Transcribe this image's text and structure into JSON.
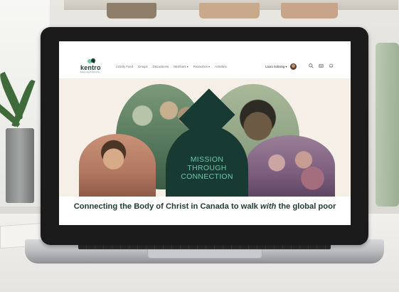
{
  "site": {
    "logo": {
      "name": "kentro",
      "subtitle": "linking church and world"
    },
    "nav_links": [
      "Activity Feed",
      "Groups",
      "Discussions",
      "Members ▾",
      "Resources ▾",
      "Activities"
    ],
    "user": {
      "name": "Laura Sobaing ▾"
    },
    "icons": [
      "search-icon",
      "inbox-icon",
      "bell-icon"
    ],
    "hero": {
      "mission_lines": [
        "MISSION",
        "THROUGH",
        "CONNECTION"
      ]
    },
    "tagline": {
      "before": "Connecting the Body of Christ in Canada to walk ",
      "emphasis": "with",
      "after": " the global poor"
    },
    "colors": {
      "brand_dark": "#173b32",
      "brand_accent": "#6fc7a7",
      "hero_background": "#f6efe8"
    }
  }
}
